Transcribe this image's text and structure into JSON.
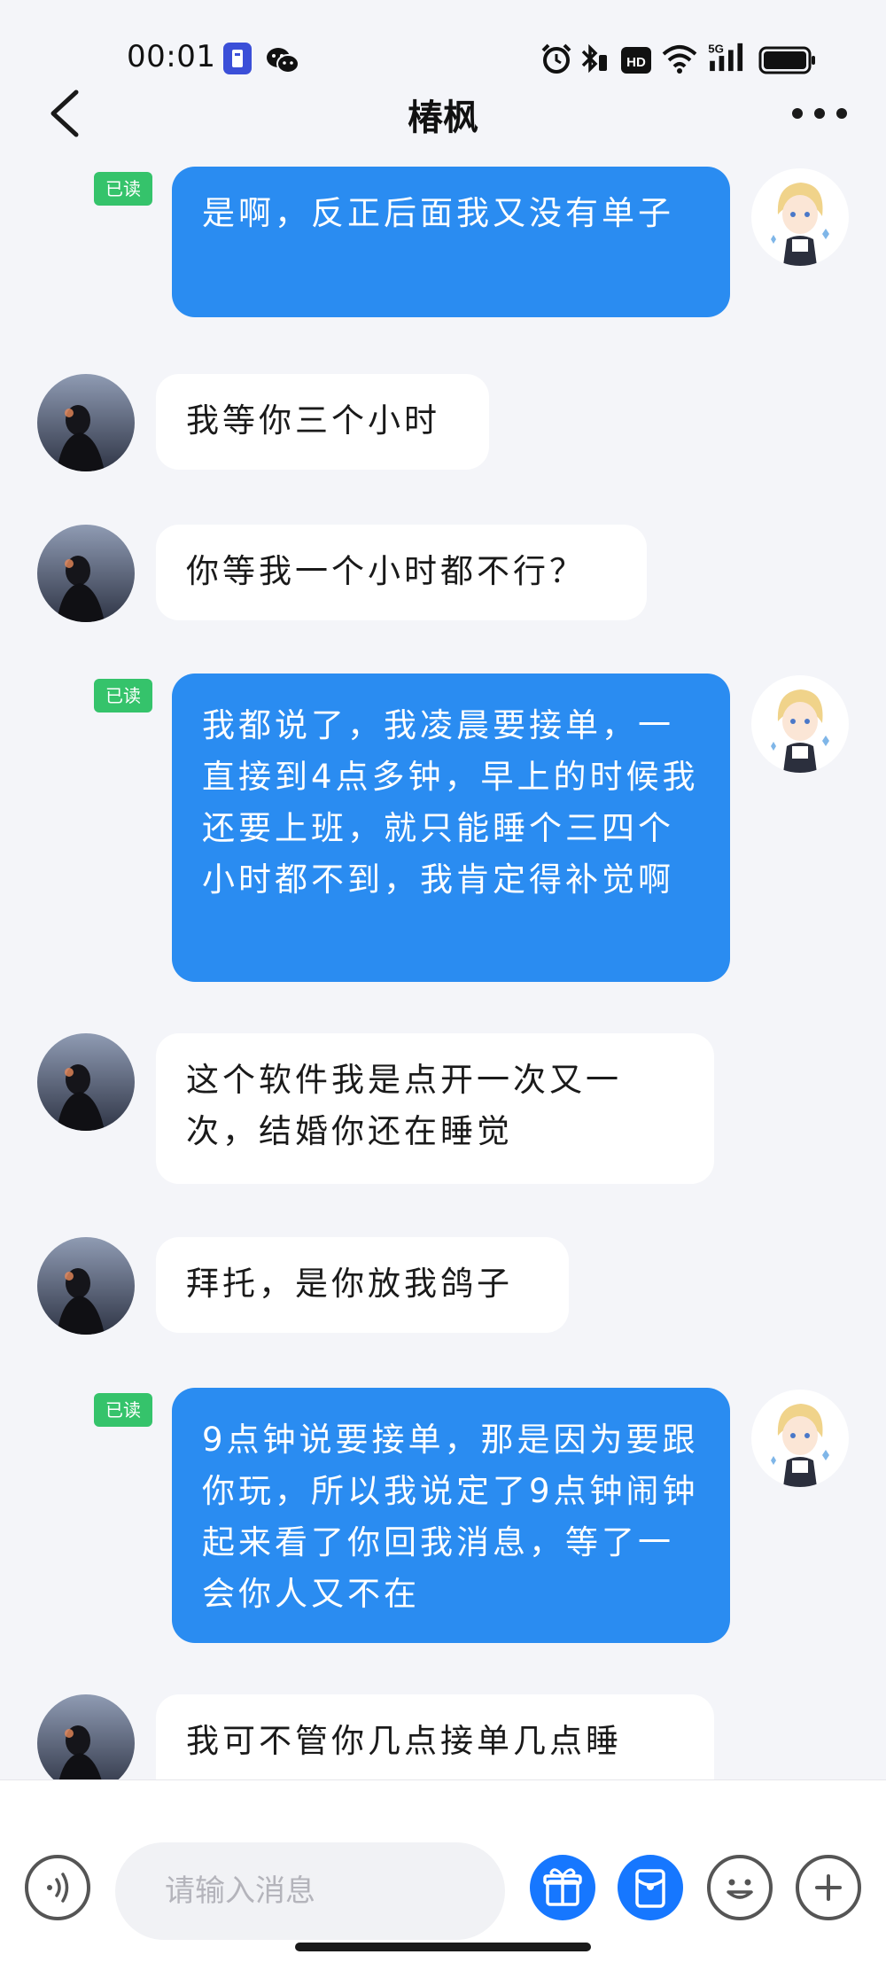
{
  "status_bar": {
    "time": "00:01",
    "left_icons": [
      "app-notification-icon",
      "wechat-icon"
    ],
    "right_icons": [
      "alarm-icon",
      "bluetooth-icon",
      "hd-icon",
      "wifi-icon",
      "5g-signal-icon",
      "battery-icon"
    ],
    "hd_label": "HD",
    "network_label": "5G"
  },
  "nav": {
    "title": "椿枫",
    "back_icon": "chevron-left-icon",
    "more_icon": "more-dots-icon"
  },
  "read_tag_label": "已读",
  "messages": [
    {
      "sender": "me",
      "read": true,
      "text": "是啊，反正后面我又没有单子"
    },
    {
      "sender": "them",
      "text": "我等你三个小时"
    },
    {
      "sender": "them",
      "text": "你等我一个小时都不行？"
    },
    {
      "sender": "me",
      "read": true,
      "text": "我都说了，我凌晨要接单，一直接到4点多钟，早上的时候我还要上班，就只能睡个三四个小时都不到，我肯定得补觉啊"
    },
    {
      "sender": "them",
      "text": "这个软件我是点开一次又一次，结婚你还在睡觉"
    },
    {
      "sender": "them",
      "text": "拜托，是你放我鸽子"
    },
    {
      "sender": "me",
      "read": true,
      "text": "9点钟说要接单，那是因为要跟你玩，所以我说定了9点钟闹钟起来看了你回我消息，等了一会你人又不在"
    },
    {
      "sender": "them",
      "text": "我可不管你几点接单几点睡"
    }
  ],
  "input_bar": {
    "placeholder": "请输入消息",
    "icons": [
      "voice-icon",
      "gift-icon",
      "red-packet-icon",
      "emoji-icon",
      "plus-icon"
    ]
  },
  "colors": {
    "my_bubble": "#2a8cf1",
    "their_bubble": "#ffffff",
    "read_tag": "#35c36b",
    "background": "#f4f5f9",
    "action_blue": "#1677ff"
  }
}
